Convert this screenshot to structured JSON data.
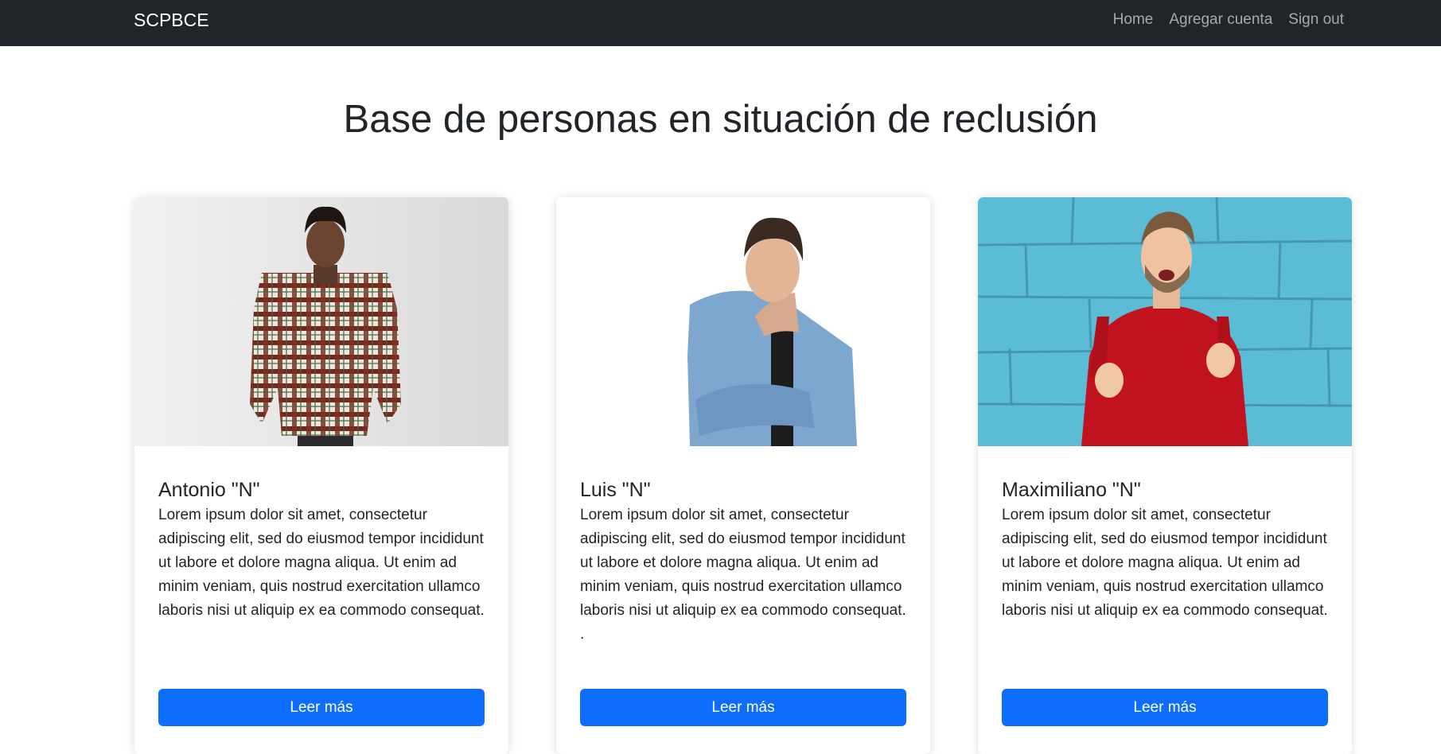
{
  "navbar": {
    "brand": "SCPBCE",
    "links": [
      "Home",
      "Agregar cuenta",
      "Sign out"
    ]
  },
  "page": {
    "title": "Base de personas en situación de reclusión"
  },
  "cards": [
    {
      "name": "Antonio \"N\"",
      "text": "Lorem ipsum dolor sit amet, consectetur adipiscing elit, sed do eiusmod tempor incididunt ut labore et dolore magna aliqua. Ut enim ad minim veniam, quis nostrud exercitation ullamco laboris nisi ut aliquip ex ea commodo consequat.",
      "button": "Leer más",
      "photo_icon": "person-plaid-shirt-photo"
    },
    {
      "name": "Luis \"N\"",
      "text": "Lorem ipsum dolor sit amet, consectetur adipiscing elit, sed do eiusmod tempor incididunt ut labore et dolore magna aliqua. Ut enim ad minim veniam, quis nostrud exercitation ullamco laboris nisi ut aliquip ex ea commodo consequat. .",
      "button": "Leer más",
      "photo_icon": "person-denim-shirt-photo"
    },
    {
      "name": "Maximiliano \"N\"",
      "text": "Lorem ipsum dolor sit amet, consectetur adipiscing elit, sed do eiusmod tempor incididunt ut labore et dolore magna aliqua. Ut enim ad minim veniam, quis nostrud exercitation ullamco laboris nisi ut aliquip ex ea commodo consequat.",
      "button": "Leer más",
      "photo_icon": "person-red-sweater-photo"
    }
  ],
  "colors": {
    "navbar_bg": "#212529",
    "button_bg": "#0d6efd",
    "wall_blue": "#5bbcd6"
  }
}
